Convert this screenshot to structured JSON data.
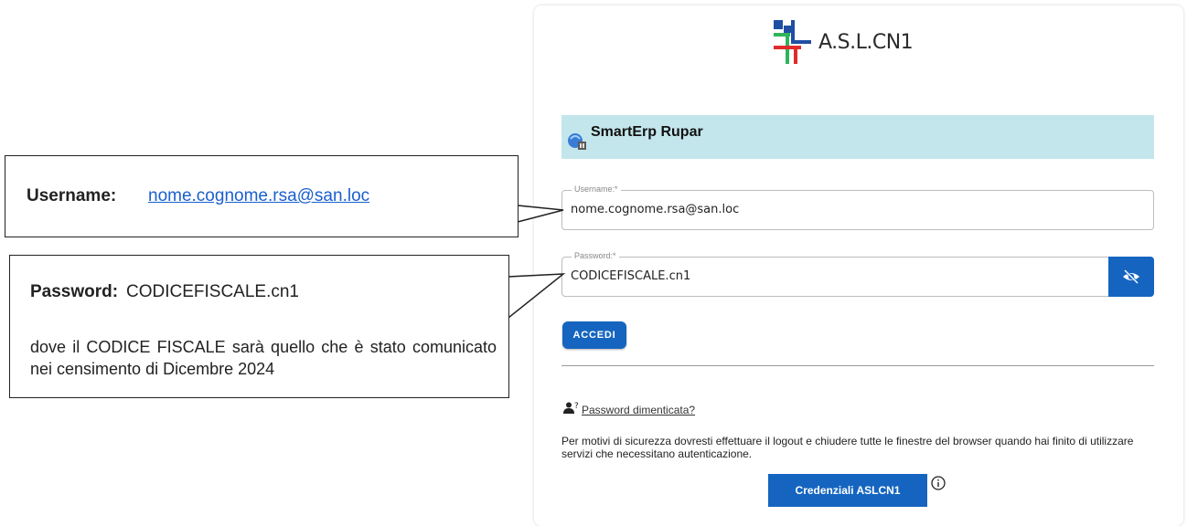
{
  "brand": {
    "logo_text": "A.S.L.CN1"
  },
  "app": {
    "title": "SmartErp Rupar"
  },
  "form": {
    "username": {
      "label": "Username:*",
      "value": "nome.cognome.rsa@san.loc"
    },
    "password": {
      "label": "Password:*",
      "value": "CODICEFISCALE.cn1"
    },
    "submit_label": "ACCEDI"
  },
  "forgot": {
    "link_text": "Password dimenticata?"
  },
  "security_notice": "Per motivi di sicurezza dovresti effettuare il logout e chiudere tutte le finestre del browser quando hai finito di utilizzare servizi che necessitano autenticazione.",
  "credentials_button": "Credenziali ASLCN1",
  "callouts": {
    "username": {
      "label": "Username:",
      "value": "nome.cognome.rsa@san.loc"
    },
    "password": {
      "label": "Password:",
      "value": "CODICEFISCALE.cn1",
      "note": "dove il CODICE FISCALE sarà quello che è stato comunicato nei censimento di Dicembre 2024"
    }
  },
  "colors": {
    "primary": "#1565c0",
    "header_bg": "#c3e6ec",
    "link": "#1a5fd0",
    "logo_blue": "#1f4fa3",
    "logo_green": "#2fb45a",
    "logo_red": "#e02b2b"
  },
  "icons": [
    "asl-logo-icon",
    "smarterp-icon",
    "eye-off-icon",
    "user-question-icon",
    "info-circle-icon"
  ]
}
